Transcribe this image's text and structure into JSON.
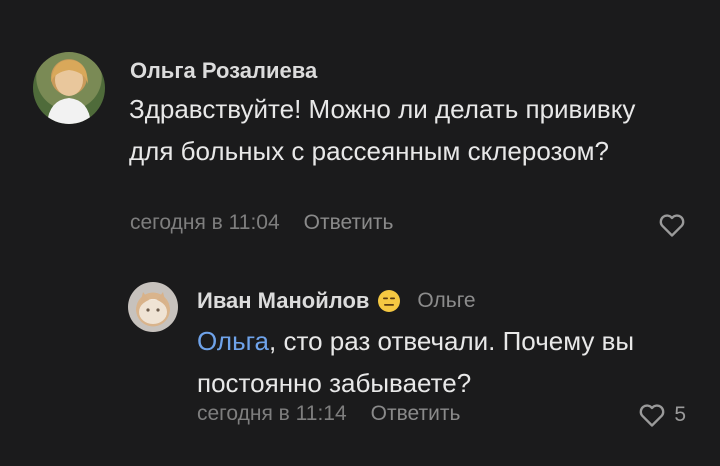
{
  "comments": [
    {
      "author": "Ольга Розалиева",
      "text": "Здравствуйте! Можно ли делать прививку для больных с рассеянным склерозом?",
      "time": "сегодня в 11:04",
      "reply_label": "Ответить",
      "likes": ""
    },
    {
      "author": "Иван Манойлов",
      "reply_to": "Ольге",
      "mention": "Ольга",
      "text": ", сто раз отвечали. Почему вы постоянно забываете?",
      "time": "сегодня в 11:14",
      "reply_label": "Ответить",
      "likes": "5"
    }
  ],
  "icons": {
    "like": "heart-outline-icon",
    "status": "neutral-face-emoji"
  },
  "colors": {
    "background": "#1b1b1c",
    "mention": "#6fa3ea",
    "muted": "#7e7e7e"
  }
}
